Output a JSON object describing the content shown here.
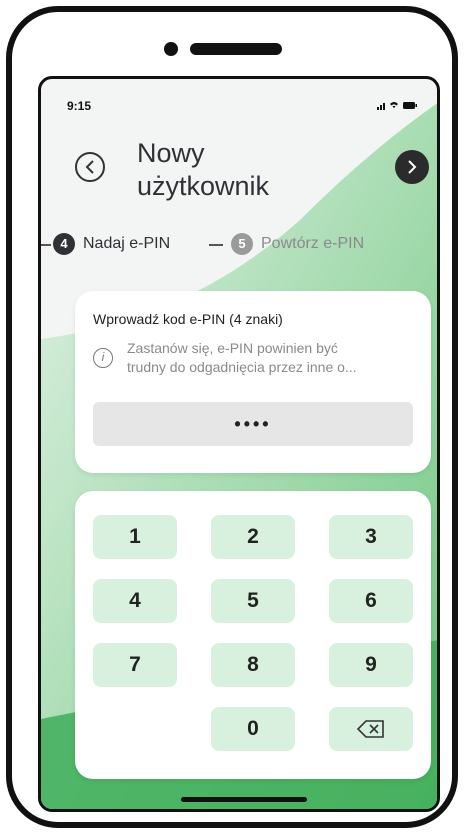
{
  "status_bar": {
    "time": "9:15",
    "icons": "signal-wifi-battery"
  },
  "header": {
    "title_line1": "Nowy",
    "title_line2": "użytkownik"
  },
  "steps": [
    {
      "number": "4",
      "label": "Nadaj e-PIN",
      "active": true
    },
    {
      "number": "5",
      "label": "Powtórz e-PIN",
      "active": false
    }
  ],
  "pin_card": {
    "title": "Wprowadź kod e-PIN (4 znaki)",
    "hint_line1": "Zastanów się, e-PIN powinien być",
    "hint_line2": "trudny do odgadnięcia przez inne o...",
    "masked_value": "••••"
  },
  "keypad": {
    "keys": [
      "1",
      "2",
      "3",
      "4",
      "5",
      "6",
      "7",
      "8",
      "9",
      "",
      "0",
      "backspace"
    ]
  },
  "colors": {
    "accent_green": "#3fae5a",
    "key_bg": "#d8f1de",
    "step_active": "#2f3136",
    "step_inactive": "#9a9a9a"
  }
}
